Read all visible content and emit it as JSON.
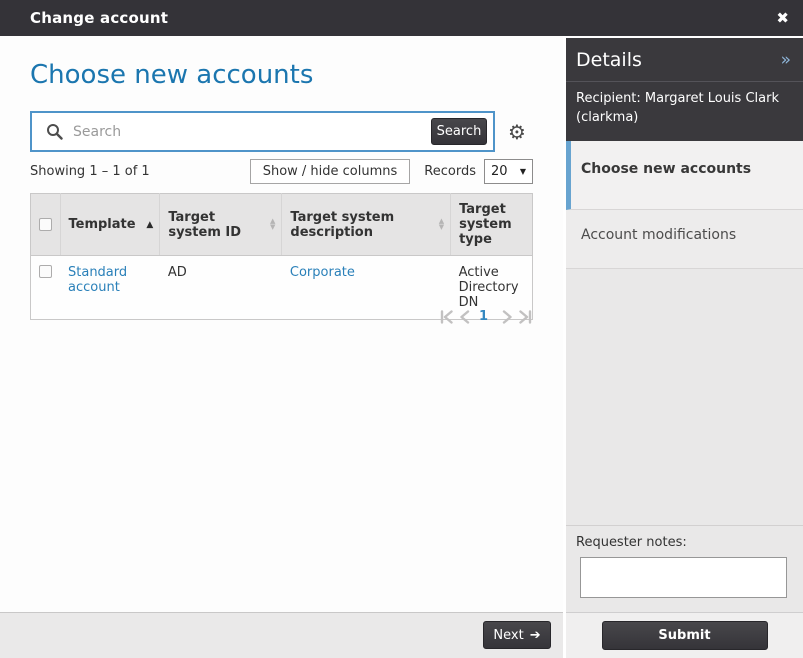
{
  "title_bar": {
    "title": "Change account"
  },
  "icons": {
    "close": "✖",
    "gear": "⚙",
    "sort_asc": "▲",
    "sort_up": "▲",
    "sort_down": "▼",
    "dropdown_arrow": "▼",
    "arrow_right": "➔",
    "chevron_double_right": "»"
  },
  "main": {
    "heading": "Choose new accounts",
    "search": {
      "placeholder": "Search",
      "button_label": "Search"
    },
    "toolbar": {
      "showing_text": "Showing 1 – 1 of 1",
      "show_hide_label": "Show / hide columns",
      "records_label": "Records",
      "records_value": "20"
    },
    "table": {
      "columns": [
        {
          "label": "Template",
          "sort": "asc"
        },
        {
          "label": "Target system ID",
          "sort": "none"
        },
        {
          "label": "Target system description",
          "sort": "none"
        },
        {
          "label": "Target system type",
          "sort": ""
        }
      ],
      "rows": [
        {
          "template": "Standard account",
          "target_system_id": "AD",
          "target_system_description": "Corporate",
          "target_system_type": "Active Directory DN"
        }
      ]
    },
    "pagination": {
      "current_page": "1"
    },
    "footer": {
      "next_label": "Next"
    }
  },
  "sidebar": {
    "header": {
      "title": "Details"
    },
    "recipient_text": "Recipient: Margaret Louis Clark (clarkma)",
    "steps": [
      {
        "label": "Choose new accounts",
        "active": true
      },
      {
        "label": "Account modifications",
        "active": false
      }
    ],
    "notes": {
      "label": "Requester notes:",
      "value": ""
    },
    "footer": {
      "submit_label": "Submit"
    }
  },
  "colors": {
    "titlebar_dark": "#343338",
    "sidebar_dark": "#3a393d",
    "heading_blue": "#1b76af",
    "link_blue": "#2a80b9",
    "search_focus_border": "#4f94c9",
    "active_step_bar": "#68a4d0",
    "table_header_bg": "#e5e4e4",
    "sidebar_bg": "#e9e8e8"
  }
}
